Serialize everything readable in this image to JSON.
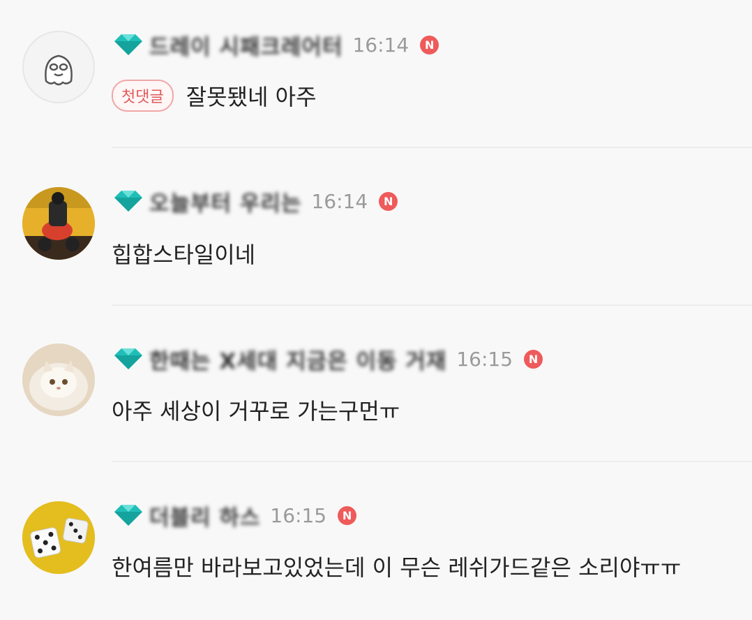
{
  "comments": [
    {
      "nickname": "드레이 시패크레어터",
      "time": "16:14",
      "new_badge": "N",
      "first_comment_badge": "첫댓글",
      "text": "잘못됐네 아주",
      "avatar": "ghost-character-avatar"
    },
    {
      "nickname": "오늘부터 우리는",
      "time": "16:14",
      "new_badge": "N",
      "text": "힙합스타일이네",
      "avatar": "scooter-photo-avatar"
    },
    {
      "nickname": "한때는 X세대 지금은 이동 거재",
      "time": "16:15",
      "new_badge": "N",
      "text": "아주 세상이 거꾸로 가는구먼ㅠ",
      "avatar": "cat-photo-avatar"
    },
    {
      "nickname": "더블리 하스",
      "time": "16:15",
      "new_badge": "N",
      "text": "한여름만 바라보고있었는데 이 무슨 레쉬가드같은 소리야ㅠㅠ",
      "avatar": "dice-photo-avatar"
    }
  ],
  "colors": {
    "background": "#f8f8f8",
    "gem": "#1fbfb8",
    "new_badge": "#ef5a5a",
    "first_badge_text": "#e05a5a",
    "time": "#9a9a9a"
  }
}
